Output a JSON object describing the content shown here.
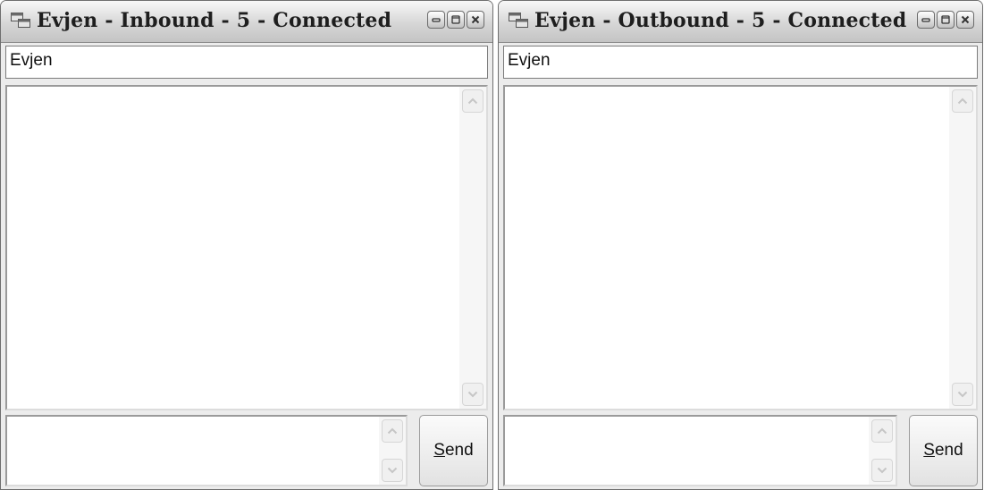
{
  "windows": [
    {
      "title": "Evjen - Inbound - 5 - Connected",
      "name_value": "Evjen",
      "log_text": "",
      "message_value": "",
      "send_label": {
        "accel": "S",
        "rest": "end"
      }
    },
    {
      "title": "Evjen  - Outbound - 5 - Connected",
      "name_value": "Evjen",
      "log_text": "",
      "message_value": "",
      "send_label": {
        "accel": "S",
        "rest": "end"
      }
    }
  ],
  "icons": {
    "app": "window-app-icon",
    "minimize": "minimize-icon",
    "maximize": "maximize-icon",
    "close": "close-icon",
    "scroll_up": "chevron-up-icon",
    "scroll_down": "chevron-down-icon"
  },
  "colors": {
    "titlebar": "#d6d6d6",
    "window_face": "#ececec",
    "field": "#ffffff"
  }
}
